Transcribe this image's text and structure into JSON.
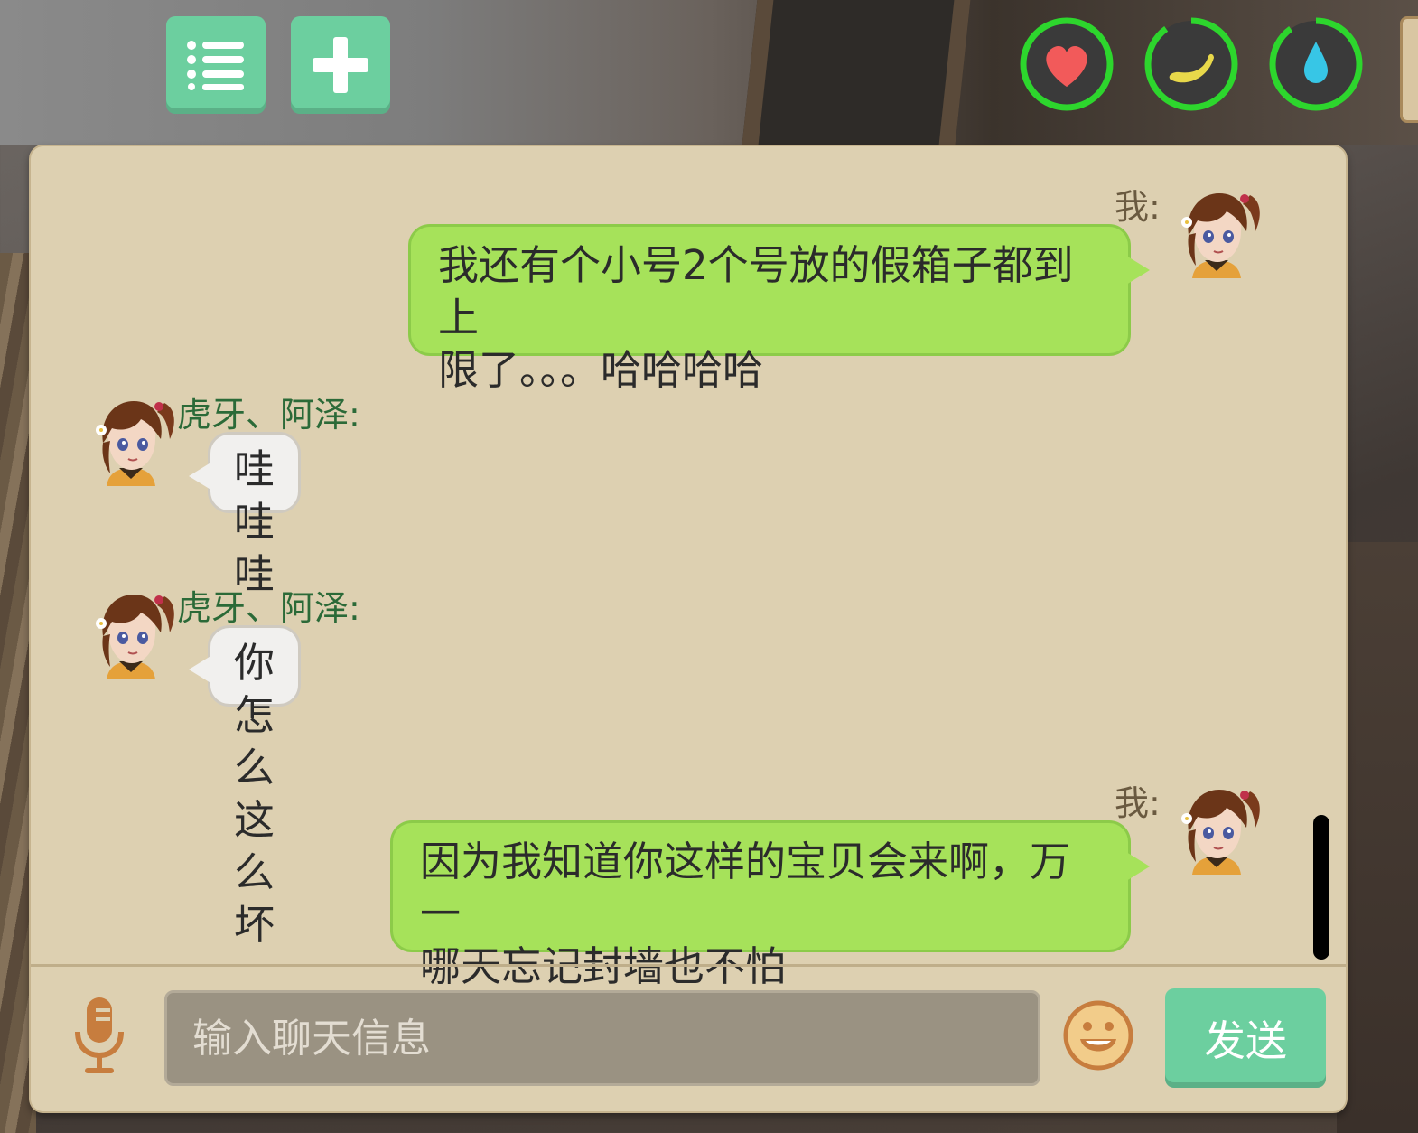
{
  "toolbar": {
    "menu_icon": "list-icon",
    "add_icon": "plus-icon"
  },
  "status": [
    {
      "name": "heart",
      "icon": "heart-icon",
      "ring_color": "#2dd62d",
      "level": 1.0,
      "color": "#f25a5a"
    },
    {
      "name": "food",
      "icon": "banana-icon",
      "ring_color": "#2dd62d",
      "level": 0.9,
      "color": "#e8d84a"
    },
    {
      "name": "water",
      "icon": "water-drop-icon",
      "ring_color": "#2dd62d",
      "level": 0.9,
      "color": "#37c6e6"
    }
  ],
  "chat": {
    "messages": [
      {
        "side": "mine",
        "sender": "我:",
        "lines": [
          "我还有个小号2个号放的假箱子都到上",
          "限了。。。哈哈哈哈"
        ]
      },
      {
        "side": "other",
        "sender": "虎牙、阿泽:",
        "lines": [
          "哇哇哇"
        ]
      },
      {
        "side": "other",
        "sender": "虎牙、阿泽:",
        "lines": [
          "你怎么这么坏"
        ]
      },
      {
        "side": "mine",
        "sender": "我:",
        "lines": [
          "因为我知道你这样的宝贝会来啊，万一",
          "哪天忘记封墙也不怕"
        ]
      }
    ]
  },
  "input": {
    "placeholder": "输入聊天信息",
    "send_label": "发送",
    "mic_icon": "microphone-icon",
    "emoji_icon": "smiley-face-icon"
  },
  "colors": {
    "accent_button": "#6ccf9f",
    "my_bubble": "#a6e25a",
    "other_bubble": "#f1f0ee",
    "panel": "#ddd0b1",
    "other_name": "#2b6a38"
  }
}
